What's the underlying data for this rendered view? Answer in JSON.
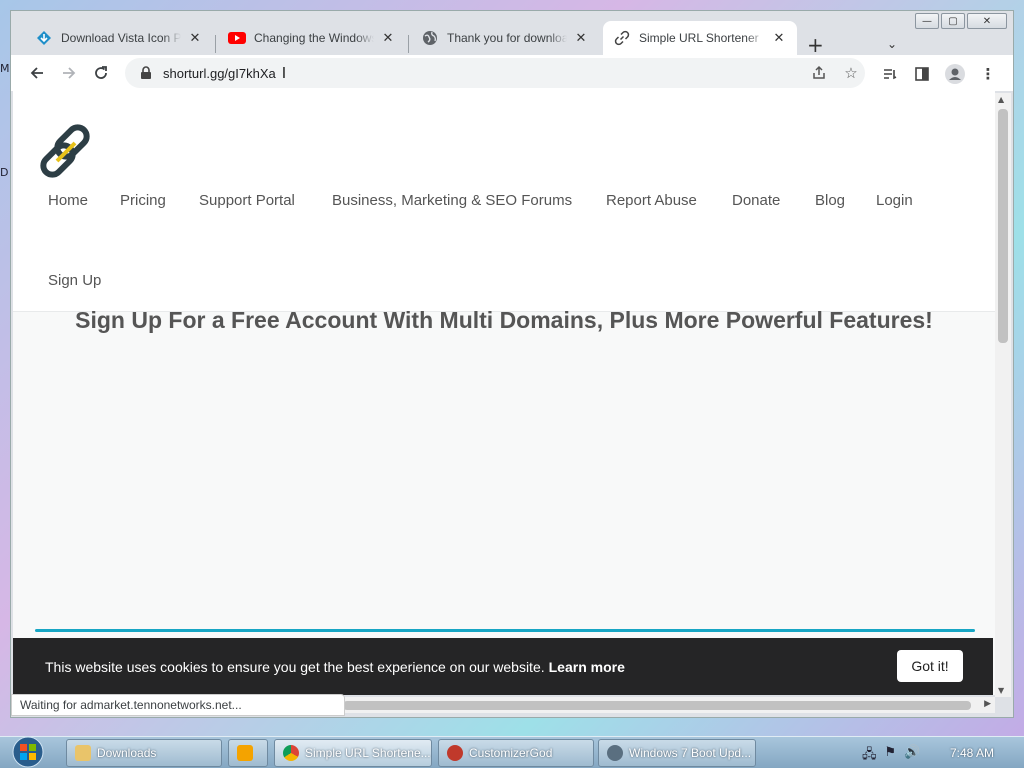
{
  "desktop": {
    "letter1": "M",
    "letter2": "D"
  },
  "window": {
    "minimize": "—",
    "maximize": "▢",
    "close": "✕"
  },
  "tabs": [
    {
      "title": "Download Vista Icon Pack",
      "close": "✕"
    },
    {
      "title": "Changing the Windows",
      "close": "✕"
    },
    {
      "title": "Thank you for downloading",
      "close": "✕"
    },
    {
      "title": "Simple URL Shortener",
      "close": "✕"
    }
  ],
  "tabstrip": {
    "new_tab": "+",
    "tab_search": "⌄"
  },
  "toolbar": {
    "url": "shorturl.gg/gI7khXa"
  },
  "site": {
    "nav": [
      "Home",
      "Pricing",
      "Support Portal",
      "Business, Marketing & SEO Forums",
      "Report Abuse",
      "Donate",
      "Blog",
      "Login",
      "Sign Up"
    ],
    "headline": "Sign Up For a Free Account With Multi Domains, Plus More Powerful Features!"
  },
  "cookie": {
    "text": "This website uses cookies to ensure you get the best experience on our website.",
    "link": "Learn more",
    "button": "Got it!"
  },
  "status": "Waiting for admarket.tennonetworks.net...",
  "taskbar": {
    "items": [
      "Downloads",
      "",
      "Simple URL Shortene...",
      "CustomizerGod",
      "Windows 7 Boot Upd..."
    ],
    "time": "7:48 AM"
  },
  "colors": {
    "accent": "#17a6c4",
    "cookie_bg": "#252526",
    "youtube": "#ff0000"
  }
}
